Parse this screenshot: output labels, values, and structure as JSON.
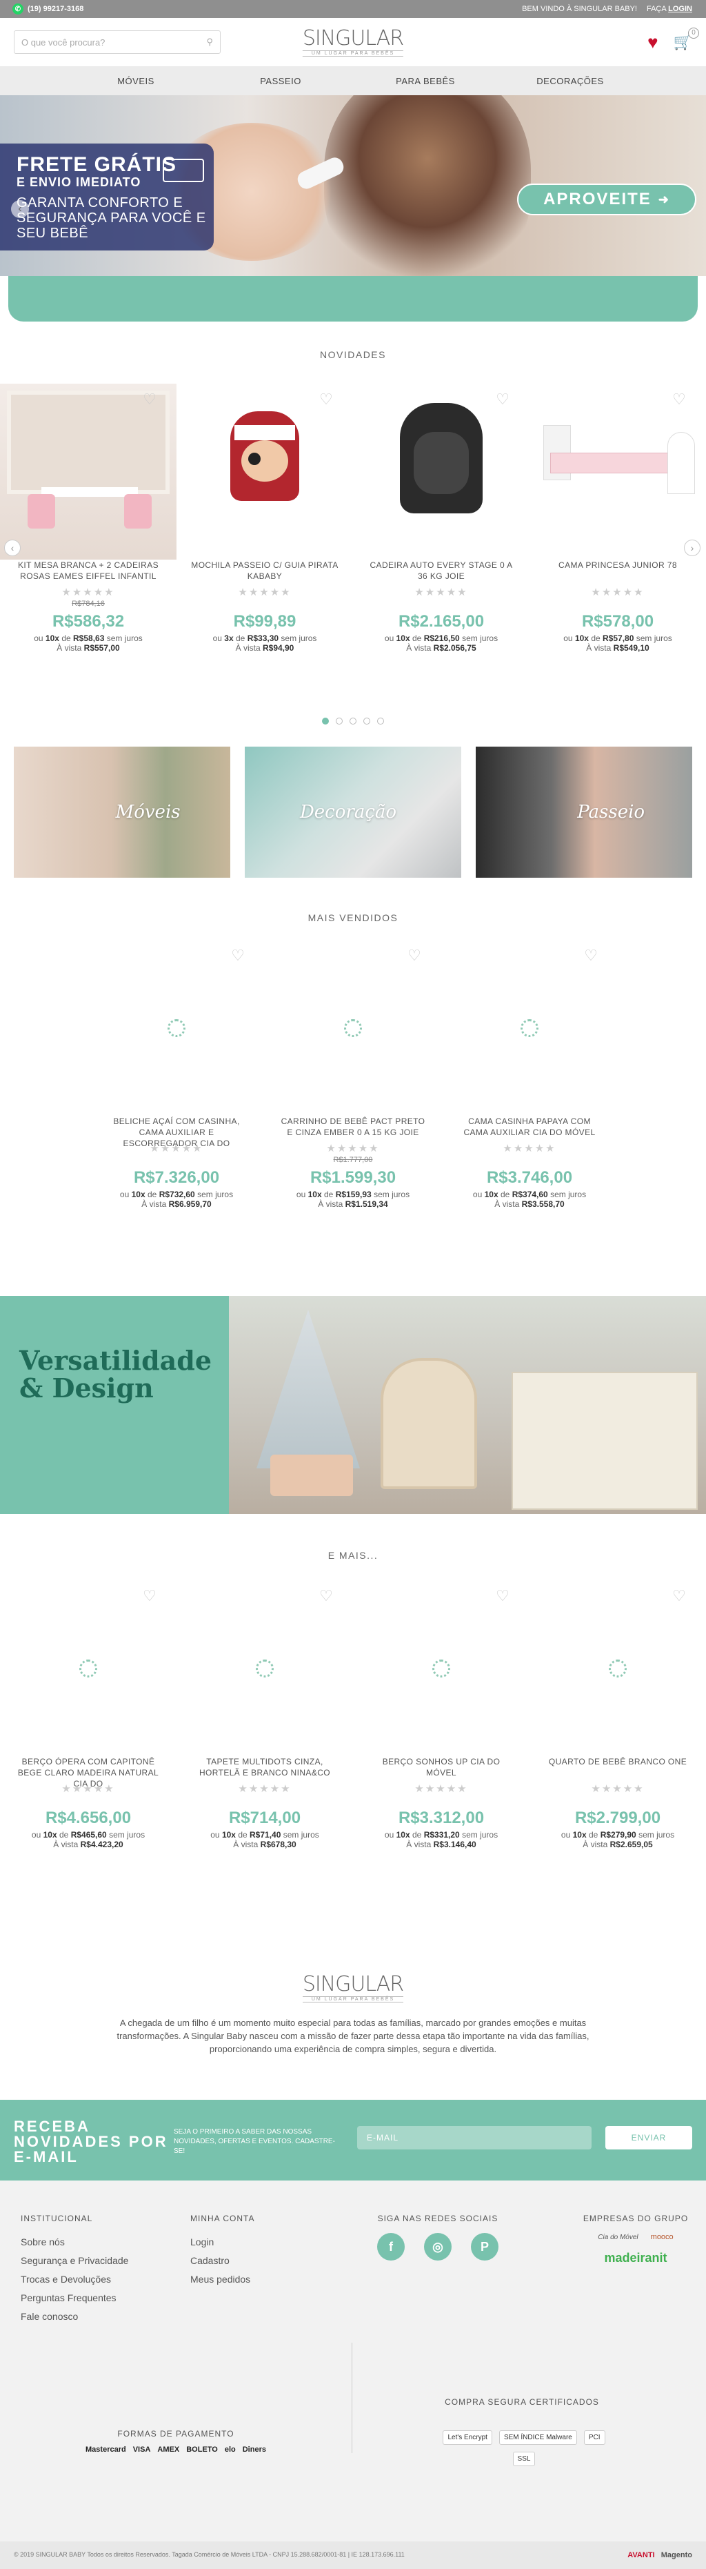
{
  "topbar": {
    "phone": "(19) 99217-3168",
    "welcome": "BEM VINDO À SINGULAR BABY!",
    "login_prefix": "FAÇA",
    "login": "LOGIN"
  },
  "header": {
    "search_placeholder": "O que você procura?",
    "logo_name": "SINGULAR",
    "logo_sub": "UM LUGAR PARA BEBÊS",
    "cart_count": "0"
  },
  "nav": [
    "MÓVEIS",
    "PASSEIO",
    "PARA BEBÊS",
    "DECORAÇÕES"
  ],
  "banner": {
    "title1": "FRETE GRÁTIS",
    "title2": "E ENVIO IMEDIATO",
    "text": "GARANTA CONFORTO E SEGURANÇA PARA VOCÊ E SEU BEBÊ",
    "cta": "APROVEITE",
    "accent": "#78c2ad"
  },
  "sections": {
    "novidades": "NOVIDADES",
    "mais_vendidos": "MAIS VENDIDOS",
    "e_mais": "E MAIS..."
  },
  "novidades": [
    {
      "name": "KIT MESA BRANCA + 2 CADEIRAS ROSAS EAMES EIFFEL INFANTIL",
      "old": "R$784,16",
      "price": "R$586,32",
      "inst_n": "10x",
      "inst_v": "R$58,63",
      "cash": "R$557,00"
    },
    {
      "name": "MOCHILA PASSEIO C/ GUIA PIRATA KABABY",
      "old": "",
      "price": "R$99,89",
      "inst_n": "3x",
      "inst_v": "R$33,30",
      "cash": "R$94,90"
    },
    {
      "name": "CADEIRA AUTO EVERY STAGE 0 A 36 KG JOIE",
      "old": "",
      "price": "R$2.165,00",
      "inst_n": "10x",
      "inst_v": "R$216,50",
      "cash": "R$2.056,75"
    },
    {
      "name": "CAMA PRINCESA JUNIOR 78",
      "old": "",
      "price": "R$578,00",
      "inst_n": "10x",
      "inst_v": "R$57,80",
      "cash": "R$549,10"
    }
  ],
  "categories": [
    "Móveis",
    "Decoração",
    "Passeio"
  ],
  "mais_vendidos": [
    {
      "name": "BELICHE AÇAÍ COM CASINHA, CAMA AUXILIAR E ESCORREGADOR CIA DO",
      "old": "",
      "price": "R$7.326,00",
      "inst_n": "10x",
      "inst_v": "R$732,60",
      "cash": "R$6.959,70"
    },
    {
      "name": "CARRINHO DE BEBÊ PACT PRETO E CINZA EMBER 0 A 15 KG JOIE",
      "old": "R$1.777,00",
      "price": "R$1.599,30",
      "inst_n": "10x",
      "inst_v": "R$159,93",
      "cash": "R$1.519,34"
    },
    {
      "name": "CAMA CASINHA PAPAYA COM CAMA AUXILIAR CIA DO MÓVEL",
      "old": "",
      "price": "R$3.746,00",
      "inst_n": "10x",
      "inst_v": "R$374,60",
      "cash": "R$3.558,70"
    }
  ],
  "versa": {
    "line1": "Versatilidade",
    "line2": "& Design"
  },
  "e_mais": [
    {
      "name": "BERÇO ÓPERA COM CAPITONÊ BEGE CLARO MADEIRA NATURAL CIA DO",
      "old": "",
      "price": "R$4.656,00",
      "inst_n": "10x",
      "inst_v": "R$465,60",
      "cash": "R$4.423,20"
    },
    {
      "name": "TAPETE MULTIDOTS CINZA, HORTELÃ E BRANCO NINA&CO",
      "old": "",
      "price": "R$714,00",
      "inst_n": "10x",
      "inst_v": "R$71,40",
      "cash": "R$678,30"
    },
    {
      "name": "BERÇO SONHOS UP CIA DO MÓVEL",
      "old": "",
      "price": "R$3.312,00",
      "inst_n": "10x",
      "inst_v": "R$331,20",
      "cash": "R$3.146,40"
    },
    {
      "name": "QUARTO DE BEBÊ BRANCO ONE",
      "old": "",
      "price": "R$2.799,00",
      "inst_n": "10x",
      "inst_v": "R$279,90",
      "cash": "R$2.659,05"
    }
  ],
  "labels": {
    "ou": "ou",
    "de": "de",
    "sem_juros": "sem juros",
    "a_vista": "À vista"
  },
  "about": {
    "logo_name": "SINGULAR",
    "logo_sub": "UM LUGAR PARA BEBÊS",
    "text": "A chegada de um filho é um momento muito especial para todas as famílias, marcado por grandes emoções e muitas transformações. A Singular Baby nasceu com a missão de fazer parte dessa etapa tão importante na vida das famílias, proporcionando uma experiência de compra simples, segura e divertida."
  },
  "newsletter": {
    "title": "RECEBA NOVIDADES POR E-MAIL",
    "info": "SEJA O PRIMEIRO A SABER DAS NOSSAS NOVIDADES, OFERTAS E EVENTOS. CADASTRE-SE!",
    "placeholder": "E-MAIL",
    "button": "ENVIAR"
  },
  "footer": {
    "institucional": {
      "title": "INSTITUCIONAL",
      "items": [
        "Sobre nós",
        "Segurança e Privacidade",
        "Trocas e Devoluções",
        "Perguntas Frequentes",
        "Fale conosco"
      ]
    },
    "conta": {
      "title": "MINHA CONTA",
      "items": [
        "Login",
        "Cadastro",
        "Meus pedidos"
      ]
    },
    "redes": {
      "title": "SIGA NAS REDES SOCIAIS"
    },
    "grupo": {
      "title": "EMPRESAS DO GRUPO",
      "brands": [
        "Cia do Móvel",
        "mooco",
        "madeiranit"
      ]
    },
    "pagamento": {
      "title": "FORMAS DE PAGAMENTO",
      "items": [
        "Mastercard",
        "VISA",
        "AMEX",
        "BOLETO",
        "elo",
        "Diners"
      ]
    },
    "seguranca": {
      "title": "COMPRA SEGURA CERTIFICADOS",
      "items": [
        "Let's Encrypt",
        "SEM ÍNDICE Malware",
        "PCI",
        "SSL"
      ]
    },
    "copyright": "© 2019 SINGULAR BABY Todos os direitos Reservados. Tagada Comércio de Móveis LTDA - CNPJ 15.288.682/0001-81 | IE 128.173.696.111",
    "powered": "AVANTI",
    "platform": "Magento"
  }
}
